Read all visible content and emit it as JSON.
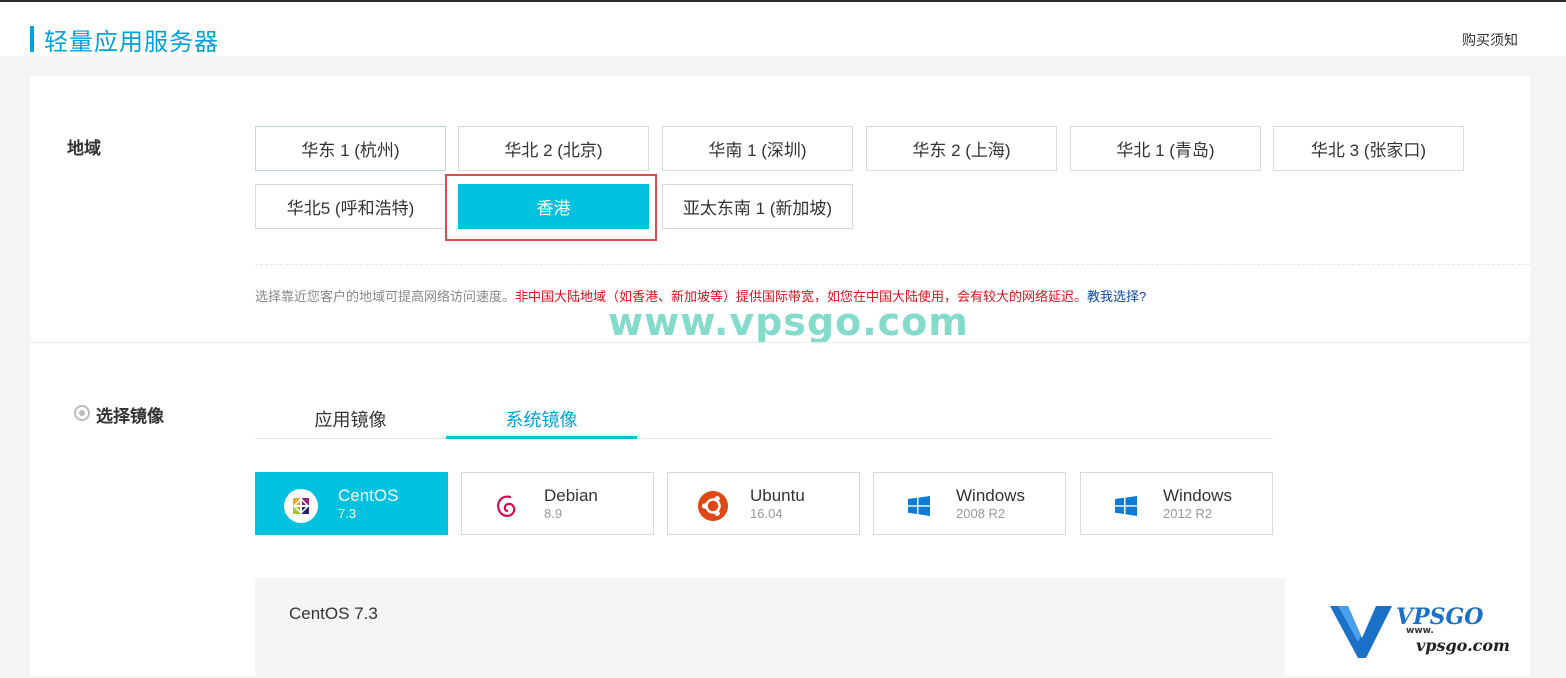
{
  "header": {
    "title": "轻量应用服务器",
    "buy_notice": "购买须知"
  },
  "region": {
    "label": "地域",
    "options": [
      {
        "label": "华东 1 (杭州)",
        "selected": false
      },
      {
        "label": "华北 2 (北京)",
        "selected": false
      },
      {
        "label": "华南 1 (深圳)",
        "selected": false
      },
      {
        "label": "华东 2 (上海)",
        "selected": false
      },
      {
        "label": "华北 1 (青岛)",
        "selected": false
      },
      {
        "label": "华北 3 (张家口)",
        "selected": false
      },
      {
        "label": "华北5 (呼和浩特)",
        "selected": false
      },
      {
        "label": "香港",
        "selected": true
      },
      {
        "label": "亚太东南 1 (新加坡)",
        "selected": false
      }
    ],
    "hint_gray": "选择靠近您客户的地域可提高网络访问速度。",
    "hint_red": "非中国大陆地域（如香港、新加坡等）提供国际带宽，如您在中国大陆使用，会有较大的网络延迟。",
    "hint_link": "教我选择?"
  },
  "watermark": "www.vpsgo.com",
  "image": {
    "label": "选择镜像",
    "tabs": [
      {
        "label": "应用镜像",
        "active": false
      },
      {
        "label": "系统镜像",
        "active": true
      }
    ],
    "os_options": [
      {
        "name": "CentOS",
        "version": "7.3",
        "icon": "centos-icon",
        "selected": true
      },
      {
        "name": "Debian",
        "version": "8.9",
        "icon": "debian-icon",
        "selected": false
      },
      {
        "name": "Ubuntu",
        "version": "16.04",
        "icon": "ubuntu-icon",
        "selected": false
      },
      {
        "name": "Windows",
        "version": "2008 R2",
        "icon": "windows-icon",
        "selected": false
      },
      {
        "name": "Windows",
        "version": "2012 R2",
        "icon": "windows-icon",
        "selected": false
      }
    ],
    "selected_detail": "CentOS 7.3"
  },
  "logo": {
    "top": "VPSGO",
    "www": "www.",
    "bottom": "vpsgo.com"
  },
  "colors": {
    "accent": "#00c1de",
    "title_blue": "#00a2d9",
    "warning_red": "#e0101d",
    "link_blue": "#0d4aa3",
    "highlight_red": "#e24b4b"
  }
}
